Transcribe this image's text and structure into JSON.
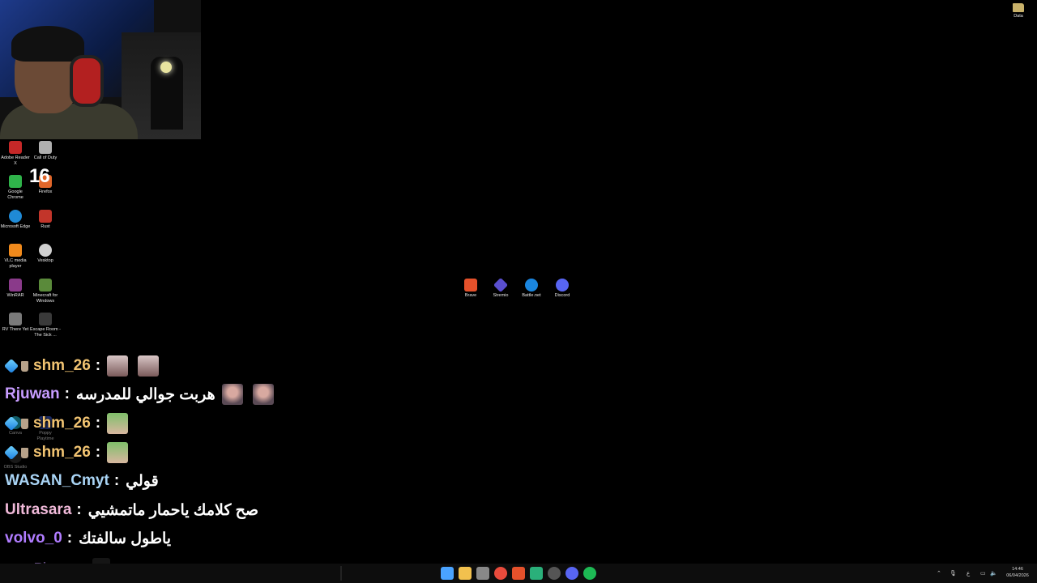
{
  "desktop": {
    "left_icons": [
      {
        "label": "Adobe Reader X",
        "color": "#c62828"
      },
      {
        "label": "Call of Duty",
        "color": "#b0b0b0"
      },
      {
        "label": "Google Chrome",
        "color": "#2fb34a"
      },
      {
        "label": "Firefox",
        "color": "#e0662a"
      },
      {
        "label": "Microsoft Edge",
        "color": "#1f8ad6"
      },
      {
        "label": "Rust",
        "color": "#c2352a"
      },
      {
        "label": "VLC media player",
        "color": "#f08a1c"
      },
      {
        "label": "Vesktop",
        "color": "#d0d0d0"
      },
      {
        "label": "WinRAR",
        "color": "#8a3a8a"
      },
      {
        "label": "Minecraft for Windows",
        "color": "#5a8a3a"
      },
      {
        "label": "RV There Yet",
        "color": "#7a7a7a"
      },
      {
        "label": "Escape Room - The Sick ...",
        "color": "#3a3a3a"
      },
      {
        "label": "Canva",
        "color": "#21b8d0"
      },
      {
        "label": "Poppy Playtime",
        "color": "#3a5ad0"
      },
      {
        "label": "OBS Studio",
        "color": "#333333"
      }
    ],
    "center_icons": [
      {
        "label": "Brave",
        "color": "#e5512b"
      },
      {
        "label": "Stremio",
        "color": "#5a4fcf"
      },
      {
        "label": "Battle.net",
        "color": "#1a86e0"
      },
      {
        "label": "Discord",
        "color": "#5865f2"
      }
    ],
    "top_right_icon": {
      "label": "Data",
      "icon": "folder-icon"
    }
  },
  "counter": "16",
  "chat": [
    {
      "user": "shm_26",
      "user_color": "#f2c472",
      "separator": ":",
      "message": "",
      "badges": true
    },
    {
      "user": "Rjuwan",
      "user_color": "#c79cff",
      "separator": ":",
      "message": "هربت جوالي للمدرسه",
      "badges": false
    },
    {
      "user": "shm_26",
      "user_color": "#f2c472",
      "separator": ":",
      "message": "",
      "badges": true
    },
    {
      "user": "shm_26",
      "user_color": "#f2c472",
      "separator": ":",
      "message": "",
      "badges": true
    },
    {
      "user": "WASAN_Cmyt",
      "user_color": "#a9d4f5",
      "separator": ":",
      "message": "قولي",
      "badges": false
    },
    {
      "user": "Ultrasara",
      "user_color": "#f0b9d9",
      "separator": ":",
      "message": "صح كلامك ياحمار ماتمشيي",
      "badges": false
    },
    {
      "user": "volvo_0",
      "user_color": "#b07cff",
      "separator": ":",
      "message": "ياطول سالفتك",
      "badges": false
    },
    {
      "user": "Rjuwan",
      "user_color": "#c79cff",
      "separator": ":",
      "message": "",
      "badges": false
    }
  ],
  "taskbar": {
    "icons": [
      {
        "name": "start-icon",
        "color": "#4aa3ff"
      },
      {
        "name": "file-explorer-icon",
        "color": "#f2c14e"
      },
      {
        "name": "store-icon",
        "color": "#888888"
      },
      {
        "name": "chrome-icon",
        "color": "#e94b3c"
      },
      {
        "name": "brave-icon",
        "color": "#e5512b"
      },
      {
        "name": "app-icon",
        "color": "#2ab07a"
      },
      {
        "name": "obs-icon",
        "color": "#555555"
      },
      {
        "name": "discord-icon",
        "color": "#5865f2"
      },
      {
        "name": "spotify-icon",
        "color": "#1db954"
      }
    ],
    "tray_lang": "ع",
    "clock_time": "14:46",
    "clock_date": "06/04/2026"
  }
}
